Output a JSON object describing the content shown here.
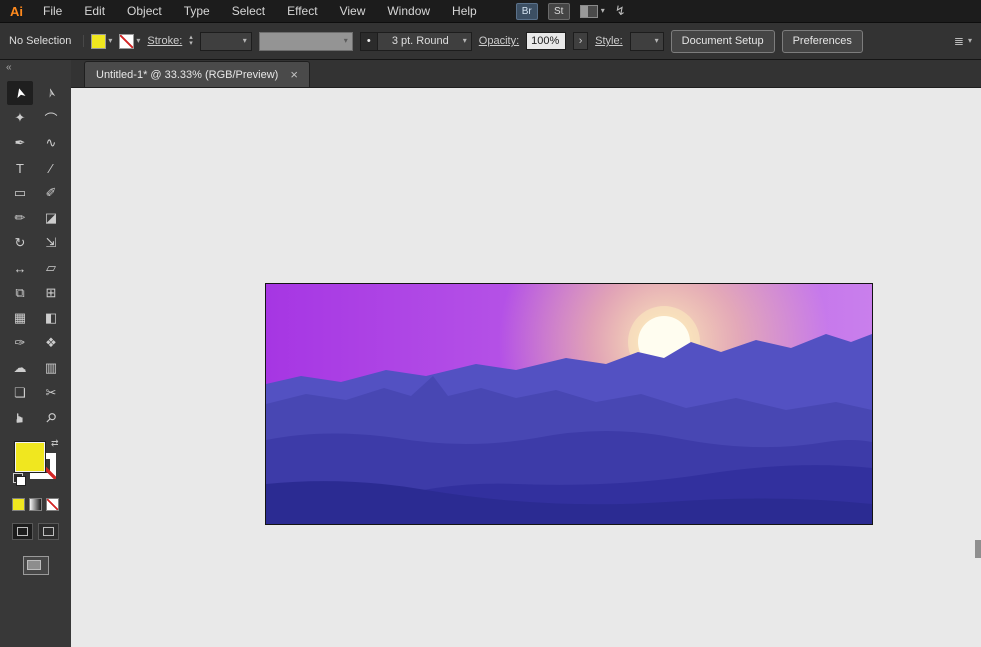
{
  "menu_bar": {
    "logo": "Ai",
    "items": [
      "File",
      "Edit",
      "Object",
      "Type",
      "Select",
      "Effect",
      "View",
      "Window",
      "Help"
    ],
    "bridge": "Br",
    "stock": "St"
  },
  "icons": {
    "chevron": "▾",
    "stepper_up": "▴",
    "stepper_down": "▾",
    "collapse": "«",
    "close": "×",
    "swap": "⇄",
    "more": "›",
    "gpu": "↯",
    "brush_dot": "•",
    "menu_lines": "≣"
  },
  "control_bar": {
    "status": "No Selection",
    "stroke_label": "Stroke:",
    "brush_value": "3 pt. Round",
    "opacity_label": "Opacity:",
    "opacity_value": "100%",
    "style_label": "Style:",
    "document_setup": "Document Setup",
    "preferences": "Preferences"
  },
  "document_tab": {
    "title": "Untitled-1* @ 33.33% (RGB/Preview)"
  },
  "colors": {
    "fill_yellow": "#f0e71f",
    "accent_orange": "#ff8a1d"
  },
  "toolbar": {
    "tools": [
      {
        "name": "selection",
        "glyph": "➤"
      },
      {
        "name": "direct-selection",
        "glyph": "➢"
      },
      {
        "name": "magic-wand",
        "glyph": "✦"
      },
      {
        "name": "lasso",
        "glyph": "⌒"
      },
      {
        "name": "pen",
        "glyph": "✒"
      },
      {
        "name": "curvature",
        "glyph": "∿"
      },
      {
        "name": "type",
        "glyph": "T"
      },
      {
        "name": "line-segment",
        "glyph": "∕"
      },
      {
        "name": "rectangle",
        "glyph": "▭"
      },
      {
        "name": "paintbrush",
        "glyph": "✐"
      },
      {
        "name": "pencil",
        "glyph": "✏"
      },
      {
        "name": "eraser",
        "glyph": "◪"
      },
      {
        "name": "rotate",
        "glyph": "↻"
      },
      {
        "name": "scale",
        "glyph": "⇲"
      },
      {
        "name": "width",
        "glyph": "↔"
      },
      {
        "name": "free-transform",
        "glyph": "▱"
      },
      {
        "name": "shape-builder",
        "glyph": "⧉"
      },
      {
        "name": "perspective-grid",
        "glyph": "⊞"
      },
      {
        "name": "mesh",
        "glyph": "▦"
      },
      {
        "name": "gradient",
        "glyph": "◧"
      },
      {
        "name": "eyedropper",
        "glyph": "✑"
      },
      {
        "name": "blend",
        "glyph": "❖"
      },
      {
        "name": "symbol-sprayer",
        "glyph": "☁"
      },
      {
        "name": "column-graph",
        "glyph": "▥"
      },
      {
        "name": "artboard",
        "glyph": "❏"
      },
      {
        "name": "slice",
        "glyph": "✂"
      },
      {
        "name": "hand",
        "glyph": "☛"
      },
      {
        "name": "zoom",
        "glyph": "⚲"
      }
    ]
  },
  "artwork": {
    "sky_left": "#a636e3",
    "sky_mid": "#ba5ce8",
    "sky_right": "#c97fec",
    "glow_inner": "#fff3c0",
    "glow_outer": "#ffd98f",
    "sun": "#fffdf0",
    "m1": "#5351c2",
    "m2": "#4847b3",
    "m3": "#3d3ba8",
    "m4": "#32309e",
    "m5": "#2b2b92"
  }
}
